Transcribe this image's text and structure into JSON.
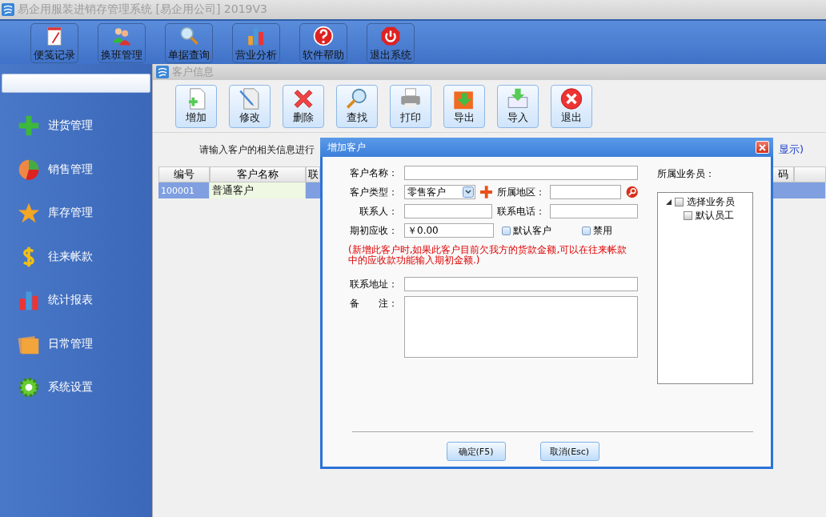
{
  "app_title": "易企用服装进销存管理系统 [易企用公司] 2019V3",
  "main_toolbar": [
    {
      "label": "便笺记录"
    },
    {
      "label": "换班管理"
    },
    {
      "label": "单据查询"
    },
    {
      "label": "营业分析"
    },
    {
      "label": "软件帮助"
    },
    {
      "label": "退出系统"
    }
  ],
  "sidebar": {
    "items": [
      {
        "label": "进货管理"
      },
      {
        "label": "销售管理"
      },
      {
        "label": "库存管理"
      },
      {
        "label": "往来帐款"
      },
      {
        "label": "统计报表"
      },
      {
        "label": "日常管理"
      },
      {
        "label": "系统设置"
      }
    ]
  },
  "customer_window": {
    "title": "客户信息",
    "toolbar": [
      {
        "label": "增加"
      },
      {
        "label": "修改"
      },
      {
        "label": "删除"
      },
      {
        "label": "查找"
      },
      {
        "label": "打印"
      },
      {
        "label": "导出"
      },
      {
        "label": "导入"
      },
      {
        "label": "退出"
      }
    ],
    "hint": "请输入客户的相关信息进行",
    "hint_tail": "显示)",
    "table": {
      "columns": [
        "编号",
        "客户名称",
        "联",
        "码"
      ],
      "rows": [
        {
          "cells": [
            "100001",
            "普通客户"
          ],
          "selected": true
        }
      ]
    }
  },
  "dialog": {
    "title": "增加客户",
    "name": {
      "label": "客户名称："
    },
    "type": {
      "label": "客户类型：",
      "value": "零售客户"
    },
    "region": {
      "label": "所属地区："
    },
    "contact": {
      "label": "联系人："
    },
    "phone": {
      "label": "联系电话："
    },
    "opening": {
      "label": "期初应收：",
      "value": "￥0.00"
    },
    "checks": [
      {
        "label": "默认客户",
        "checked": false
      },
      {
        "label": "禁用",
        "checked": false
      }
    ],
    "note": "(新增此客户时,如果此客户目前欠我方的货款金额,可以在往来帐款中的应收款功能输入期初金额.)",
    "address": {
      "label": "联系地址："
    },
    "remark": {
      "label": "备　　注："
    },
    "staff": {
      "label": "所属业务员：",
      "tree": [
        {
          "label": "选择业务员",
          "checked": false,
          "expanded": true,
          "children": [
            {
              "label": "默认员工",
              "checked": false
            }
          ]
        }
      ]
    },
    "buttons": [
      "确定(F5)",
      "取消(Esc)"
    ]
  }
}
